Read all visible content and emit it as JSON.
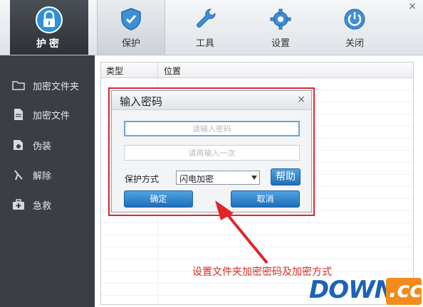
{
  "toolbar": {
    "logo_label": "护密",
    "tabs": [
      {
        "label": "保护",
        "icon": "shield-icon"
      },
      {
        "label": "工具",
        "icon": "wrench-icon"
      },
      {
        "label": "设置",
        "icon": "gear-icon"
      },
      {
        "label": "关闭",
        "icon": "power-icon"
      }
    ],
    "active_tab": "保护"
  },
  "window": {
    "close_glyph": "×"
  },
  "sidebar": {
    "items": [
      {
        "label": "加密文件夹",
        "icon": "folder-icon"
      },
      {
        "label": "加密文件",
        "icon": "file-icon"
      },
      {
        "label": "伪装",
        "icon": "disguise-icon"
      },
      {
        "label": "解除",
        "icon": "unlock-icon"
      },
      {
        "label": "急救",
        "icon": "first-aid-icon"
      }
    ]
  },
  "list": {
    "columns": [
      "类型",
      "位置"
    ]
  },
  "dialog": {
    "title": "输入密码",
    "close_glyph": "×",
    "password_placeholder": "请输入密码",
    "confirm_placeholder": "请再输入一次",
    "protect_label": "保护方式",
    "protect_selected": "闪电加密",
    "help_button": "帮助",
    "ok_button": "确定",
    "cancel_button": "取消"
  },
  "annotation": {
    "text": "设置文件夹加密密码及加密方式",
    "color": "#d62b27"
  },
  "watermark": {
    "brand": "DOWN",
    "suffix": ".cc"
  }
}
